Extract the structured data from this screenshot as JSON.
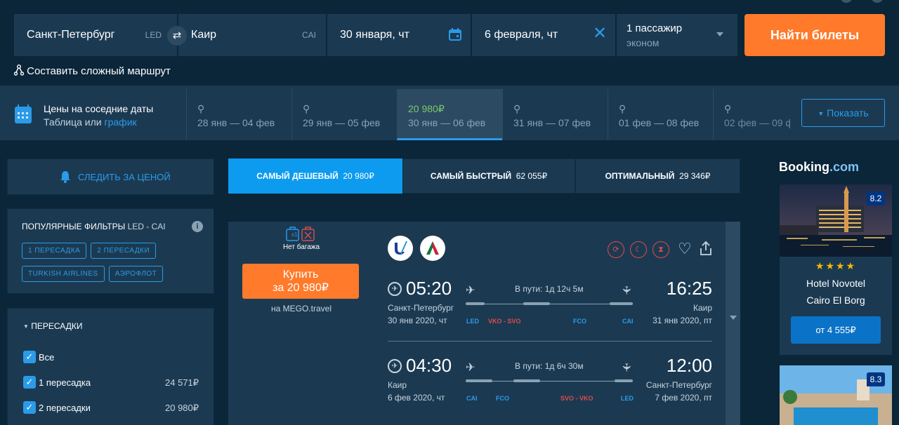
{
  "search": {
    "from": "Санкт-Петербург",
    "from_code": "LED",
    "to": "Каир",
    "to_code": "CAI",
    "depart": "30 января, чт",
    "return": "6 февраля, чт",
    "passengers": "1 пассажир",
    "class": "эконом",
    "find_label": "Найти билеты",
    "complex_route": "Составить сложный маршрут"
  },
  "dates": {
    "title": "Цены на соседние даты",
    "subtitle_table": "Таблица",
    "subtitle_or": "или",
    "subtitle_link": "график",
    "cells": [
      {
        "range": "28 янв — 04 фев",
        "price": ""
      },
      {
        "range": "29 янв — 05 фев",
        "price": ""
      },
      {
        "range": "30 янв — 06 фев",
        "price": "20 980₽"
      },
      {
        "range": "31 янв — 07 фев",
        "price": ""
      },
      {
        "range": "01 фев — 08 фев",
        "price": ""
      },
      {
        "range": "02 фев — 09 ф",
        "price": ""
      }
    ],
    "show_label": "Показать"
  },
  "sidebar": {
    "track_price": "СЛЕДИТЬ ЗА ЦЕНОЙ",
    "popular_title": "ПОПУЛЯРНЫЕ ФИЛЬТРЫ",
    "popular_route": "LED - CAI",
    "chips": [
      "1 ПЕРЕСАДКА",
      "2 ПЕРЕСАДКИ",
      "TURKISH AIRLINES",
      "АЭРОФЛОТ"
    ],
    "stops_title": "ПЕРЕСАДКИ",
    "stops": [
      {
        "label": "Все",
        "price": ""
      },
      {
        "label": "1 пересадка",
        "price": "24 571₽"
      },
      {
        "label": "2 пересадки",
        "price": "20 980₽"
      }
    ]
  },
  "tabs": [
    {
      "label": "САМЫЙ ДЕШЕВЫЙ",
      "price": "20 980₽"
    },
    {
      "label": "САМЫЙ БЫСТРЫЙ",
      "price": "62 055₽"
    },
    {
      "label": "ОПТИМАЛЬНЫЙ",
      "price": "29 346₽"
    }
  ],
  "ticket": {
    "baggage_badge": "x1",
    "baggage": "Нет багажа",
    "buy_line1": "Купить",
    "buy_line2": "за 20 980₽",
    "seller": "на MEGO.travel",
    "outbound": {
      "dep_time": "05:20",
      "dep_city": "Санкт-Петербург",
      "dep_date": "30 янв 2020, чт",
      "arr_time": "16:25",
      "arr_city": "Каир",
      "arr_date": "31 янв 2020, пт",
      "duration": "В пути: 1д 12ч 5м",
      "airports": [
        "LED",
        "VKO - SVO",
        "FCO",
        "CAI"
      ]
    },
    "inbound": {
      "dep_time": "04:30",
      "dep_city": "Каир",
      "dep_date": "6 фев 2020, чт",
      "arr_time": "12:00",
      "arr_city": "Санкт-Петербург",
      "arr_date": "7 фев 2020, пт",
      "duration": "В пути: 1д 6ч 30м",
      "airports": [
        "CAI",
        "FCO",
        "SVO - VKO",
        "LED"
      ]
    }
  },
  "booking": {
    "logo_a": "Booking",
    "logo_b": ".com",
    "hotels": [
      {
        "rating": "8.2",
        "stars": "★★★★",
        "name1": "Hotel Novotel",
        "name2": "Cairo El Borg",
        "price": "от 4 555₽"
      },
      {
        "rating": "8.3"
      }
    ]
  },
  "colors": {
    "accent": "#2b9be8",
    "orange": "#ff7a2a",
    "panel": "#1b3a52",
    "bg": "#0b2539"
  }
}
